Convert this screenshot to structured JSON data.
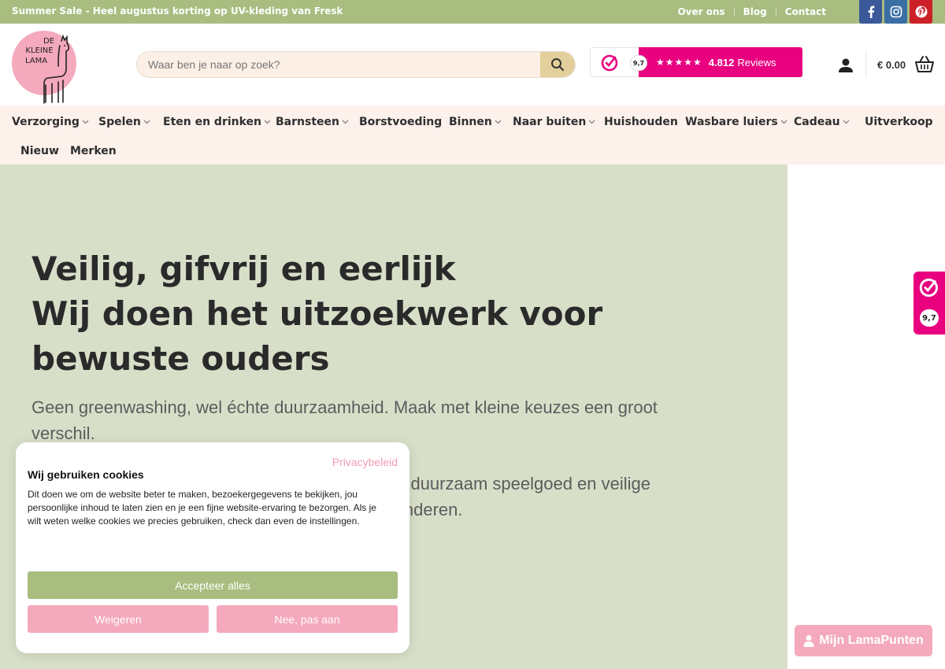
{
  "topbar": {
    "promo": "Summer Sale - Heel augustus korting op UV-kleding van Fresk",
    "links": [
      "Over ons",
      "Blog",
      "Contact"
    ],
    "social": [
      {
        "icon": "facebook-icon",
        "color": "#3b5998"
      },
      {
        "icon": "instagram-icon",
        "color": "#3a6ea5"
      },
      {
        "icon": "pinterest-icon",
        "color": "#cb2027"
      }
    ]
  },
  "header": {
    "logo_text": [
      "DE",
      "KLEINE",
      "LAMA"
    ],
    "search_placeholder": "Waar ben je naar op zoek?",
    "review": {
      "score": "9,7",
      "stars": "★★★★★",
      "count": "4.812",
      "label": "Reviews"
    },
    "cart_total": "€ 0.00"
  },
  "nav": {
    "items": [
      {
        "label": "Verzorging",
        "dropdown": true
      },
      {
        "label": "Spelen",
        "dropdown": true
      },
      {
        "label": "Eten en drinken",
        "dropdown": true
      },
      {
        "label": "Barnsteen",
        "dropdown": true
      },
      {
        "label": "Borstvoeding",
        "dropdown": false
      },
      {
        "label": "Binnen",
        "dropdown": true
      },
      {
        "label": "Naar buiten",
        "dropdown": true
      },
      {
        "label": "Huishouden",
        "dropdown": false
      },
      {
        "label": "Wasbare luiers",
        "dropdown": true
      },
      {
        "label": "Cadeau",
        "dropdown": true
      },
      {
        "label": "Uitverkoop",
        "dropdown": false
      },
      {
        "label": "Nieuw",
        "dropdown": false
      },
      {
        "label": "Merken",
        "dropdown": false
      }
    ]
  },
  "hero": {
    "title_line1": "Veilig, gifvrij en eerlijk",
    "title_line2": "Wij doen het uitzoekwerk voor bewuste ouders",
    "subtitle1": "Geen greenwashing, wel échte duurzaamheid. Maak met kleine keuzes een groot verschil.",
    "subtitle2_visible": "g, duurzaam speelgoed en veilige",
    "subtitle2_line2_visible": "kinderen."
  },
  "side_review": {
    "score": "9,7"
  },
  "loyalty_button": "Mijn LamaPunten",
  "cookie": {
    "privacy_link": "Privacybeleid",
    "title": "Wij gebruiken cookies",
    "text": "Dit doen we om de website beter te maken, bezoekergegevens te bekijken, jou persoonlijke inhoud te laten zien en je een fijne website-ervaring te bezorgen. Als je wilt weten welke cookies we precies gebruiken, check dan even de instellingen.",
    "accept": "Accepteer alles",
    "refuse": "Weigeren",
    "customize": "Nee, pas aan"
  },
  "colors": {
    "green": "#a8bd7f",
    "hero_bg": "#d8dfc9",
    "pink_brand": "#e8007f",
    "pink_soft": "#f4a9bd",
    "nav_bg": "#fdf1ec"
  }
}
